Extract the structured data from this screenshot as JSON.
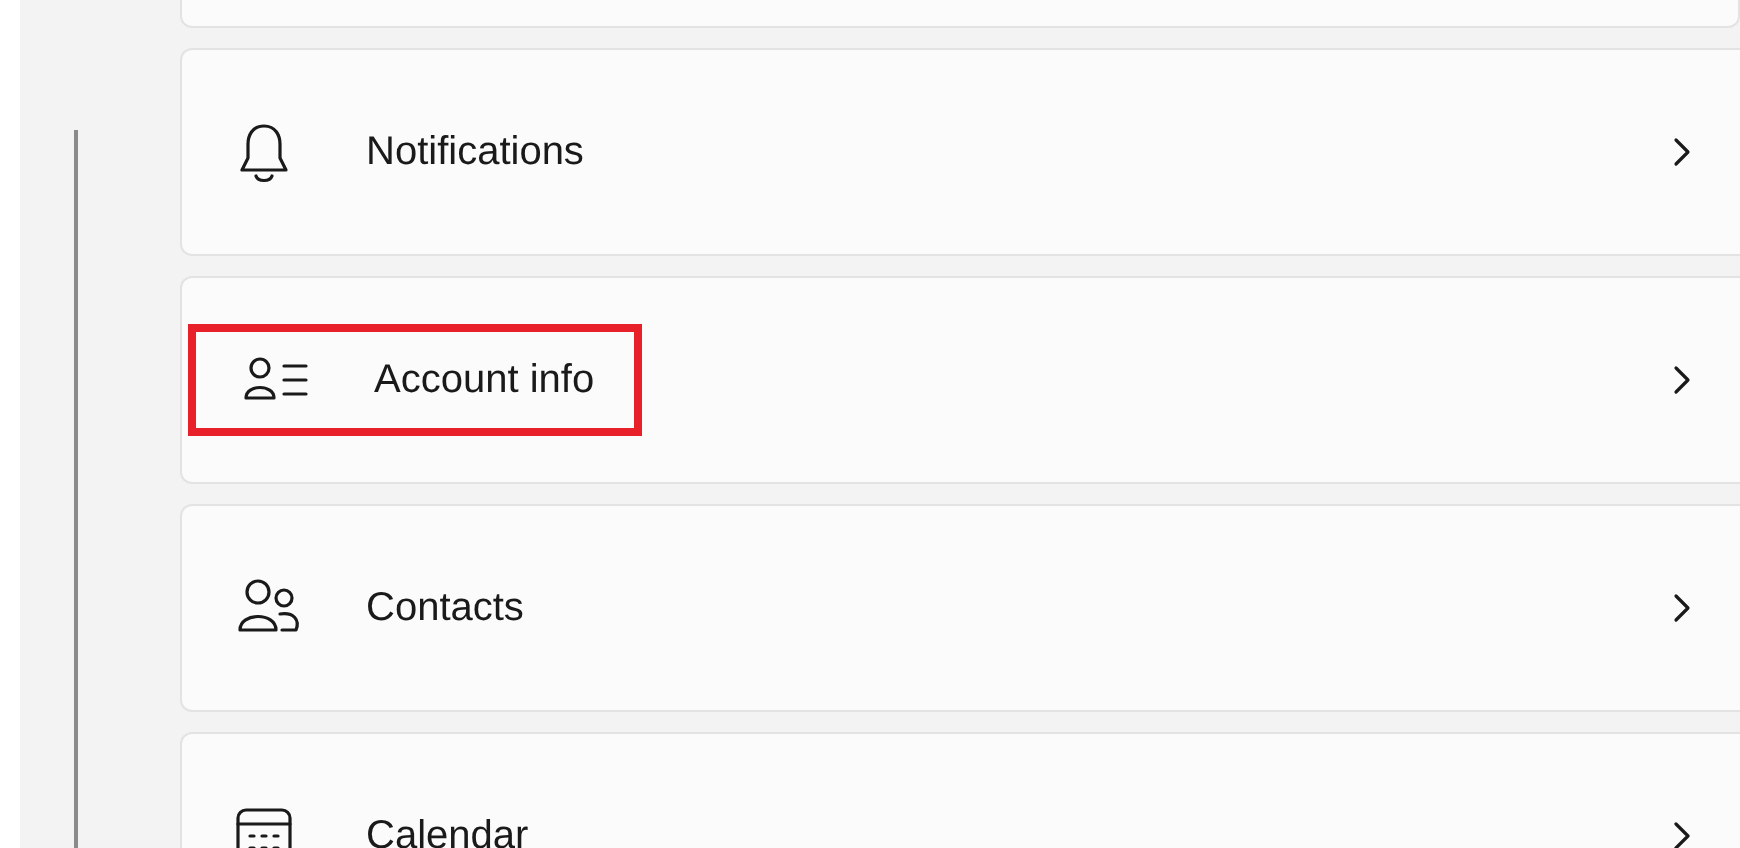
{
  "settings": [
    {
      "kind": "bell",
      "label": "Notifications",
      "highlighted": false
    },
    {
      "kind": "person-list",
      "label": "Account info",
      "highlighted": true
    },
    {
      "kind": "people",
      "label": "Contacts",
      "highlighted": false
    },
    {
      "kind": "calendar",
      "label": "Calendar",
      "highlighted": false
    }
  ]
}
